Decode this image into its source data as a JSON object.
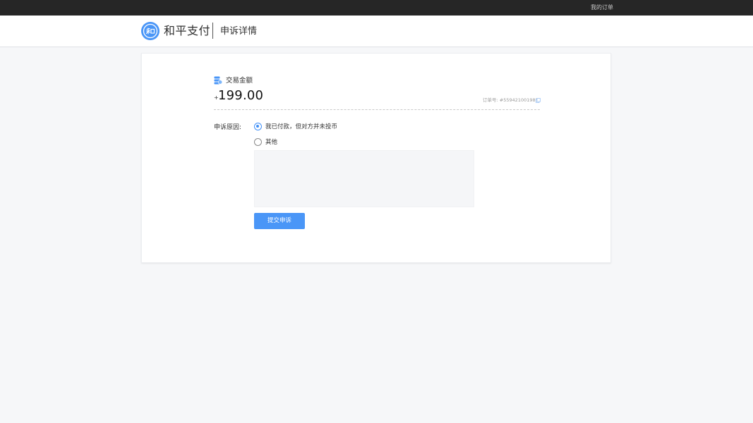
{
  "topbar": {
    "my_orders_link": "我的订单"
  },
  "header": {
    "brand_name": "和平支付",
    "page_title": "申诉详情",
    "logo_icon": "peace-pay-logo",
    "logo_color": "#4a96f7"
  },
  "transaction": {
    "icon": "coins-icon",
    "label": "交易金额",
    "currency_symbol": "+",
    "amount": "199.00",
    "order_label": "订单号: #559421001985",
    "copy_icon": "copy-icon"
  },
  "appeal": {
    "reason_label": "申诉原因:",
    "options": [
      {
        "label": "我已付款，但对方并未投币",
        "checked": true
      },
      {
        "label": "其他",
        "checked": false
      }
    ],
    "textarea_value": "",
    "submit_label": "提交申诉"
  },
  "colors": {
    "accent": "#4a96f7",
    "topbar_bg": "#262626",
    "page_bg": "#f6f7f9"
  }
}
